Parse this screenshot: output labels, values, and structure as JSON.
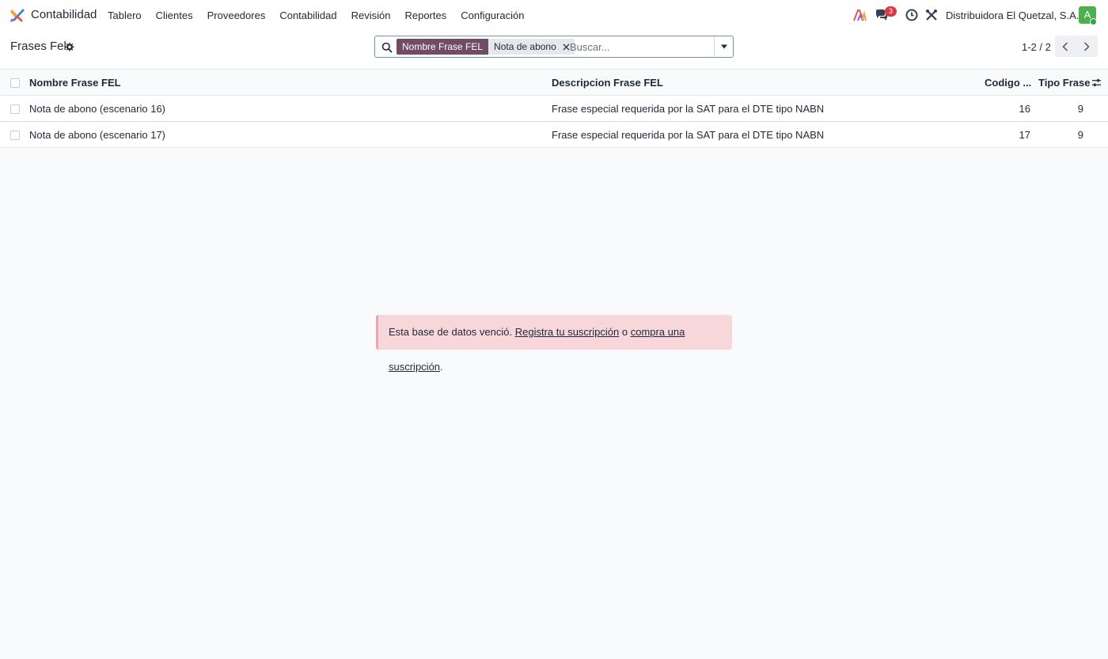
{
  "navbar": {
    "app_name": "Contabilidad",
    "menu": [
      "Tablero",
      "Clientes",
      "Proveedores",
      "Contabilidad",
      "Revisión",
      "Reportes",
      "Configuración"
    ],
    "messages_count": "3",
    "company": "Distribuidora El Quetzal, S.A.",
    "avatar_letter": "A"
  },
  "control_panel": {
    "title": "Frases Fel",
    "search": {
      "facet_label": "Nombre Frase FEL",
      "facet_value": "Nota de abono",
      "placeholder": "Buscar..."
    },
    "pager": "1-2 / 2"
  },
  "list": {
    "headers": {
      "name": "Nombre Frase FEL",
      "description": "Descripcion Frase FEL",
      "code": "Codigo ...",
      "type": "Tipo Frase"
    },
    "rows": [
      {
        "name": "Nota de abono (escenario 16)",
        "description": "Frase especial requerida por la SAT para el DTE tipo NABN",
        "code": "16",
        "type": "9"
      },
      {
        "name": "Nota de abono (escenario 17)",
        "description": "Frase especial requerida por la SAT para el DTE tipo NABN",
        "code": "17",
        "type": "9"
      }
    ]
  },
  "alert": {
    "text_before": "Esta base de datos venció. ",
    "link_register": "Registra tu suscripción",
    "text_middle": " o ",
    "link_buy": "compra una suscripción",
    "text_after": "."
  },
  "colors": {
    "brand": "#714b67",
    "alert_bg": "#f7d7da",
    "badge": "#dc3545",
    "avatar": "#4caf50"
  },
  "icons": [
    "app-logo",
    "ai-icon",
    "chat-icon",
    "clock-icon",
    "tools-icon",
    "gear-icon",
    "search-icon",
    "close-icon",
    "caret-down-icon",
    "chevron-left-icon",
    "chevron-right-icon",
    "sliders-icon"
  ]
}
